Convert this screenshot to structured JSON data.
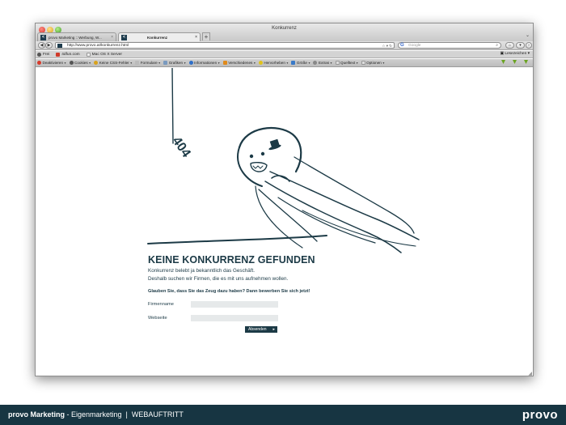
{
  "window": {
    "title": "Konkurrenz",
    "tabs": [
      {
        "label": "provo Marketing :: Werbung, W...",
        "active": false
      },
      {
        "label": "Konkurrenz",
        "active": true
      }
    ],
    "new_tab": "+"
  },
  "navbar": {
    "back": "◀",
    "forward": "▶",
    "url": "http://www.provo.at/konkurrenz.html",
    "search_placeholder": "Google",
    "reading_list": "Lesezeichen"
  },
  "bookmarks": {
    "items": [
      "Frei",
      "4dfun.com",
      "Mac OS X Server"
    ]
  },
  "devbar": {
    "items": [
      "Deaktivieren",
      "Cookies",
      "Keine CSS-Fehler",
      "Formulare",
      "Grafiken",
      "Informationen",
      "Verschiedenes",
      "Hervorheben",
      "Größe",
      "Extras",
      "Quelltext",
      "Optionen"
    ]
  },
  "page": {
    "sign_text": "404",
    "headline": "KEINE KONKURRENZ GEFUNDEN",
    "lead_line1": "Konkurrenz belebt ja bekanntlich das Geschäft.",
    "lead_line2": "Deshalb suchen wir Firmen, die es mit uns aufnehmen wollen.",
    "question": "Glauben Sie, dass Sie das Zeug dazu haben? Dann bewerben Sie sich jetzt!",
    "form": {
      "company_label": "Firmenname",
      "company_value": "",
      "website_label": "Webseite",
      "website_value": "",
      "submit_label": "Absenden"
    }
  },
  "footer": {
    "brand": "provo Marketing",
    "rest": " - Eigenmarketing  |  WEBAUFTRITT",
    "logo": "provo"
  },
  "colors": {
    "primary": "#1c3a46",
    "footer_bg": "#173542",
    "input_bg": "#e6e9ea"
  }
}
